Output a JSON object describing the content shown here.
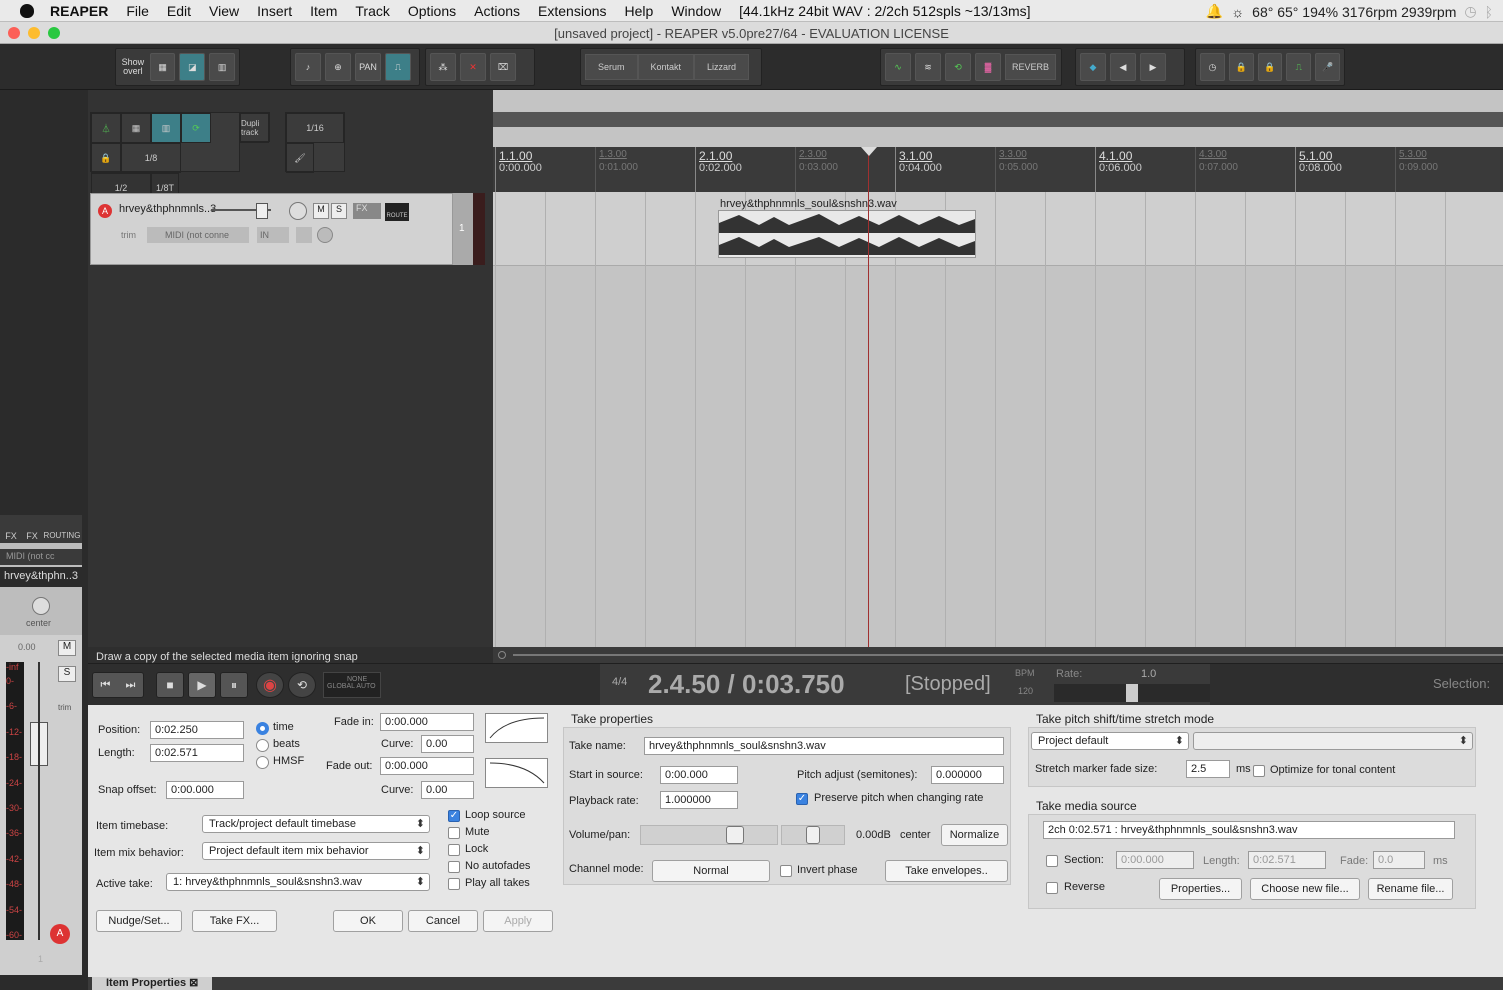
{
  "menubar": {
    "app": "REAPER",
    "items": [
      "File",
      "Edit",
      "View",
      "Insert",
      "Item",
      "Track",
      "Options",
      "Actions",
      "Extensions",
      "Help",
      "Window"
    ],
    "status": "[44.1kHz 24bit WAV : 2/2ch 512spls ~13/13ms]",
    "right": "68° 65° 194% 3176rpm 2939rpm"
  },
  "window": {
    "title": "[unsaved project] - REAPER v5.0pre27/64 - EVALUATION LICENSE"
  },
  "toolbar": {
    "show_overl": "Show overl",
    "plugins": [
      "Serum",
      "Kontakt",
      "Lizzard"
    ],
    "reverb": "REVERB"
  },
  "grid_toolbar": {
    "dupli": "Dupli track",
    "fractions": [
      "1/8",
      "1/2",
      "1/8T"
    ],
    "sixteenth": "1/16"
  },
  "track": {
    "name": "hrvey&thphnmnls..3",
    "m": "M",
    "s": "S",
    "fx": "FX",
    "route": "ROUTE",
    "trim": "trim",
    "midi": "MIDI (not conne",
    "in": "IN",
    "number": "1"
  },
  "ruler": {
    "marks": [
      {
        "bar": "1.1.00",
        "time": "0:00.000",
        "major": true
      },
      {
        "bar": "1.3.00",
        "time": "0:01.000",
        "major": false
      },
      {
        "bar": "2.1.00",
        "time": "0:02.000",
        "major": true
      },
      {
        "bar": "2.3.00",
        "time": "0:03.000",
        "major": false
      },
      {
        "bar": "3.1.00",
        "time": "0:04.000",
        "major": true
      },
      {
        "bar": "3.3.00",
        "time": "0:05.000",
        "major": false
      },
      {
        "bar": "4.1.00",
        "time": "0:06.000",
        "major": true
      },
      {
        "bar": "4.3.00",
        "time": "0:07.000",
        "major": false
      },
      {
        "bar": "5.1.00",
        "time": "0:08.000",
        "major": true
      },
      {
        "bar": "5.3.00",
        "time": "0:09.000",
        "major": false
      }
    ]
  },
  "item": {
    "name": "hrvey&thphnmnls_soul&snshn3.wav"
  },
  "statusbar": {
    "hint": "Draw a copy of the selected media item ignoring snap"
  },
  "transport": {
    "timesig": "4/4",
    "position": "2.4.50 / 0:03.750",
    "state": "[Stopped]",
    "bpm_label": "BPM",
    "bpm": "120",
    "rate_label": "Rate:",
    "rate": "1.0",
    "selection": "Selection:",
    "none": "NONE",
    "global_auto": "GLOBAL AUTO"
  },
  "mcp": {
    "fx": "FX",
    "routing": "ROUTING",
    "midi": "MIDI (not cc",
    "name": "hrvey&thphn..3",
    "pan": "center",
    "vol": "0.00",
    "inf": "-inf",
    "m": "M",
    "s": "S",
    "trim": "trim",
    "number": "1",
    "scale": [
      "0-",
      "-6-",
      "-12-",
      "-18-",
      "-24-",
      "-30-",
      "-36-",
      "-42-",
      "-48-",
      "-54-",
      "-60-"
    ]
  },
  "item_props": {
    "position_label": "Position:",
    "position": "0:02.250",
    "length_label": "Length:",
    "length": "0:02.571",
    "snap_label": "Snap offset:",
    "snap": "0:00.000",
    "timebase_options": [
      "time",
      "beats",
      "HMSF"
    ],
    "fadein_label": "Fade in:",
    "fadein": "0:00.000",
    "curve_label": "Curve:",
    "curve_in": "0.00",
    "fadeout_label": "Fade out:",
    "fadeout": "0:00.000",
    "curve_out": "0.00",
    "item_timebase_label": "Item timebase:",
    "item_timebase": "Track/project default timebase",
    "mix_label": "Item mix behavior:",
    "mix": "Project default item mix behavior",
    "active_take_label": "Active take:",
    "active_take": "1: hrvey&thphnmnls_soul&snshn3.wav",
    "checks": [
      {
        "label": "Loop source",
        "checked": true
      },
      {
        "label": "Mute",
        "checked": false
      },
      {
        "label": "Lock",
        "checked": false
      },
      {
        "label": "No autofades",
        "checked": false
      },
      {
        "label": "Play all takes",
        "checked": false
      }
    ],
    "nudge": "Nudge/Set...",
    "takefx": "Take FX...",
    "ok": "OK",
    "cancel": "Cancel",
    "apply": "Apply"
  },
  "take_props": {
    "title": "Take properties",
    "name_label": "Take name:",
    "name": "hrvey&thphnmnls_soul&snshn3.wav",
    "start_label": "Start in source:",
    "start": "0:00.000",
    "pitch_label": "Pitch adjust (semitones):",
    "pitch": "0.000000",
    "rate_label": "Playback rate:",
    "rate": "1.000000",
    "preserve": "Preserve pitch when changing rate",
    "volpan_label": "Volume/pan:",
    "vol": "0.00dB",
    "pan": "center",
    "normalize": "Normalize",
    "channel_label": "Channel mode:",
    "channel": "Normal",
    "invert": "Invert phase",
    "envelopes": "Take envelopes.."
  },
  "pitch_mode": {
    "title": "Take pitch shift/time stretch mode",
    "mode": "Project default",
    "fade_label": "Stretch marker fade size:",
    "fade": "2.5",
    "ms": "ms",
    "optimize": "Optimize for tonal content"
  },
  "media_source": {
    "title": "Take media source",
    "source": "2ch 0:02.571 : hrvey&thphnmnls_soul&snshn3.wav",
    "section": "Section:",
    "section_val": "0:00.000",
    "length_label": "Length:",
    "length": "0:02.571",
    "fade_label": "Fade:",
    "fade": "0.0",
    "ms": "ms",
    "reverse": "Reverse",
    "properties": "Properties...",
    "choose": "Choose new file...",
    "rename": "Rename file..."
  },
  "dock": {
    "tab": "Item Properties"
  }
}
